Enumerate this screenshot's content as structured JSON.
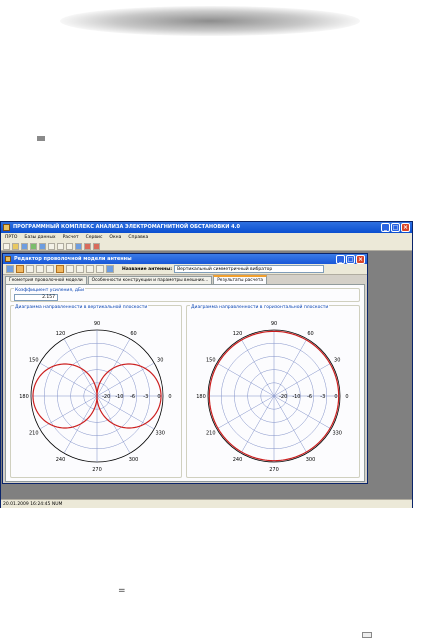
{
  "app": {
    "title": "ПРОГРАММНЫЙ КОМПЛЕКС АНАЛИЗА ЭЛЕКТРОМАГНИТНОЙ ОБСТАНОВКИ 4.0",
    "menu": [
      "ПРТО",
      "Базы данных",
      "Расчет",
      "Сервис",
      "Окна",
      "Справка"
    ],
    "status": "20.01.2009 16:24:45 NUM"
  },
  "editor": {
    "title": "Редактор проволочной модели антенны",
    "antenna_name_label": "Название антенны:",
    "antenna_name": "Вертикальный симметричный вибратор",
    "tabs": [
      "Геометрия проволочной модели",
      "Особенности конструкции и параметры внешних...",
      "Результаты расчета"
    ],
    "active_tab": 2,
    "coef_label": "Коэффициент усиления, дБи",
    "coef_value": "2.157"
  },
  "chart_data": [
    {
      "type": "polar",
      "title": "Диаграмма направленности в вертикальной плоскости",
      "angle_labels": [
        "0",
        "30",
        "60",
        "90",
        "120",
        "150",
        "180",
        "210",
        "240",
        "270",
        "300",
        "330"
      ],
      "radial_labels": [
        "-20",
        "-10",
        "-6",
        "-3",
        "0"
      ],
      "series": [
        {
          "pattern": "figure-eight",
          "max_angles_deg": [
            0,
            180
          ],
          "nulls_deg": [
            90,
            270
          ],
          "color": "#cc1f1f"
        }
      ]
    },
    {
      "type": "polar",
      "title": "Диаграмма направленности в горизонтальной плоскости",
      "angle_labels": [
        "0",
        "30",
        "60",
        "90",
        "120",
        "150",
        "180",
        "210",
        "240",
        "270",
        "300",
        "330"
      ],
      "radial_labels": [
        "-20",
        "-10",
        "-6",
        "-3",
        "0"
      ],
      "series": [
        {
          "pattern": "omnidirectional",
          "level_db": 0,
          "color": "#cc1f1f"
        }
      ]
    }
  ]
}
